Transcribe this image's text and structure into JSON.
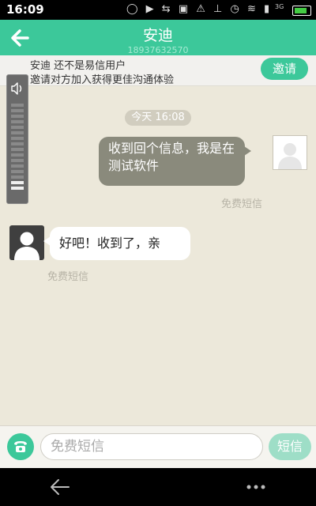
{
  "status_bar": {
    "time": "16:09",
    "icons": "◯ ▶ ⇆ ▣ ⚠ ⊥ ◷ ≋ ▮",
    "network": "3G"
  },
  "header": {
    "title": "安迪",
    "subtitle": "18937632570"
  },
  "invite": {
    "line1": "安迪 还不是易信用户",
    "line2": "邀请对方加入获得更佳沟通体验",
    "button": "邀请"
  },
  "volume": {
    "level": 0.125
  },
  "chat": {
    "timestamp": "今天 16:08",
    "messages": [
      {
        "direction": "out",
        "text": "收到回个信息，我是在测试软件",
        "label": "免费短信"
      },
      {
        "direction": "in",
        "text": "好吧！收到了，亲",
        "label": "免费短信"
      }
    ]
  },
  "input": {
    "placeholder": "免费短信",
    "send_label": "短信"
  },
  "colors": {
    "accent": "#3cc89a",
    "outgoing_bubble": "#8a8a7c",
    "background": "#ece8da"
  }
}
